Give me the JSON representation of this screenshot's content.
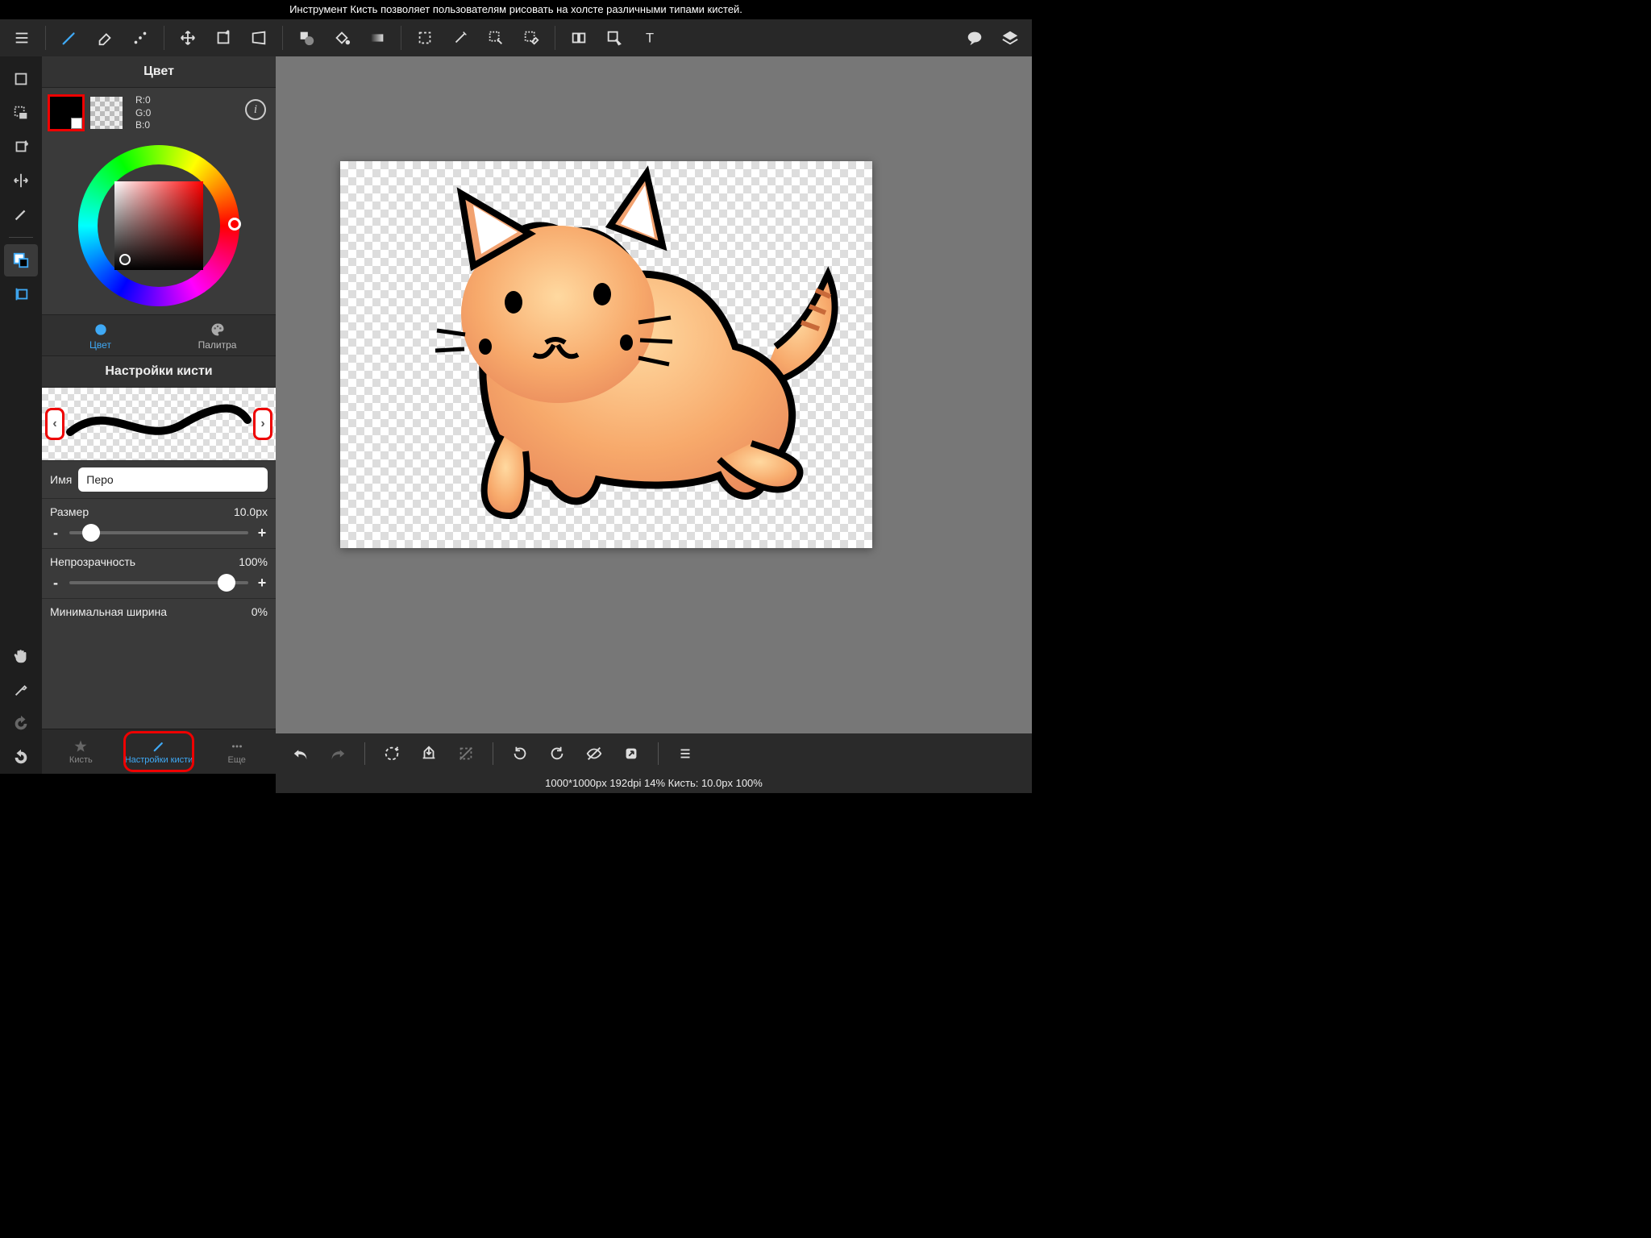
{
  "infobar": "Инструмент Кисть позволяет пользователям рисовать на холсте различными типами кистей.",
  "toolbar": {
    "icons": [
      "menu",
      "brush",
      "eraser",
      "fx-brush",
      "move",
      "transform",
      "free-transform",
      "shape",
      "bucket",
      "gradient",
      "select-rect",
      "magic-wand",
      "heal",
      "select-eraser",
      "crop",
      "pointer",
      "text",
      "chat",
      "layers"
    ]
  },
  "rail": {
    "icons": [
      "screen",
      "select-stack",
      "rotate-canvas",
      "flip",
      "edit-tool",
      "overlap-color",
      "guides"
    ],
    "lower": [
      "hand",
      "eyedropper",
      "redo",
      "undo"
    ]
  },
  "color_panel": {
    "title": "Цвет",
    "r_label": "R:0",
    "g_label": "G:0",
    "b_label": "B:0",
    "tab_color": "Цвет",
    "tab_palette": "Палитра"
  },
  "brush_panel": {
    "title": "Настройки кисти",
    "name_label": "Имя",
    "name_value": "Перо",
    "size_label": "Размер",
    "size_value": "10.0px",
    "size_pct": 12,
    "opacity_label": "Непрозрачность",
    "opacity_value": "100%",
    "opacity_pct": 88,
    "minwidth_label": "Минимальная ширина",
    "minwidth_value": "0%"
  },
  "panel_tabs": {
    "brush": "Кисть",
    "settings": "Настройки кисти",
    "more": "Еще"
  },
  "statusbar": "1000*1000px 192dpi 14% Кисть: 10.0px 100%"
}
